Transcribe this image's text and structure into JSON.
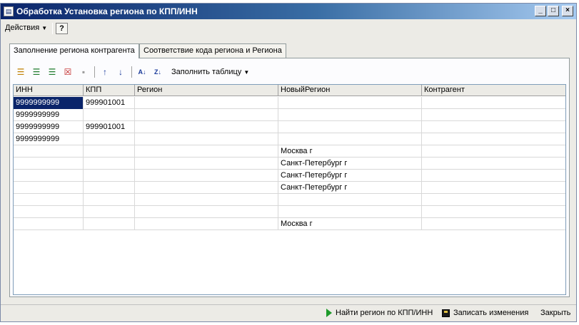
{
  "window": {
    "title": "Обработка  Установка региона по КПП/ИНН",
    "title_icon": "document-icon"
  },
  "menu": {
    "actions_label": "Действия",
    "help_label": "?"
  },
  "tabs": [
    {
      "label": "Заполнение региона контрагента",
      "active": true
    },
    {
      "label": "Соответствие кода региона и Региона",
      "active": false
    }
  ],
  "toolbar": {
    "fill_table_label": "Заполнить таблицу"
  },
  "table": {
    "columns": [
      "ИНН",
      "КПП",
      "Регион",
      "НовыйРегион",
      "Контрагент"
    ],
    "rows": [
      {
        "inn": "9999999999",
        "kpp": "999901001",
        "region": "",
        "new_region": "",
        "contractor": ""
      },
      {
        "inn": "9999999999",
        "kpp": "",
        "region": "",
        "new_region": "",
        "contractor": ""
      },
      {
        "inn": "9999999999",
        "kpp": "999901001",
        "region": "",
        "new_region": "",
        "contractor": ""
      },
      {
        "inn": "9999999999",
        "kpp": "",
        "region": "",
        "new_region": "",
        "contractor": ""
      },
      {
        "inn": "",
        "kpp": "",
        "region": "",
        "new_region": "Москва г",
        "contractor": ""
      },
      {
        "inn": "",
        "kpp": "",
        "region": "",
        "new_region": "Санкт-Петербург г",
        "contractor": ""
      },
      {
        "inn": "",
        "kpp": "",
        "region": "",
        "new_region": "Санкт-Петербург г",
        "contractor": ""
      },
      {
        "inn": "",
        "kpp": "",
        "region": "",
        "new_region": "Санкт-Петербург г",
        "contractor": ""
      },
      {
        "inn": "",
        "kpp": "",
        "region": "",
        "new_region": "",
        "contractor": ""
      },
      {
        "inn": "",
        "kpp": "",
        "region": "",
        "new_region": "",
        "contractor": ""
      },
      {
        "inn": "",
        "kpp": "",
        "region": "",
        "new_region": "Москва г",
        "contractor": ""
      }
    ]
  },
  "statusbar": {
    "find_region_label": "Найти регион по КПП/ИНН",
    "save_label": "Записать изменения",
    "close_label": "Закрыть"
  },
  "colors": {
    "title_gradient_start": "#0a246a",
    "selection": "#0a246a",
    "find_icon": "#1d9a2a"
  }
}
